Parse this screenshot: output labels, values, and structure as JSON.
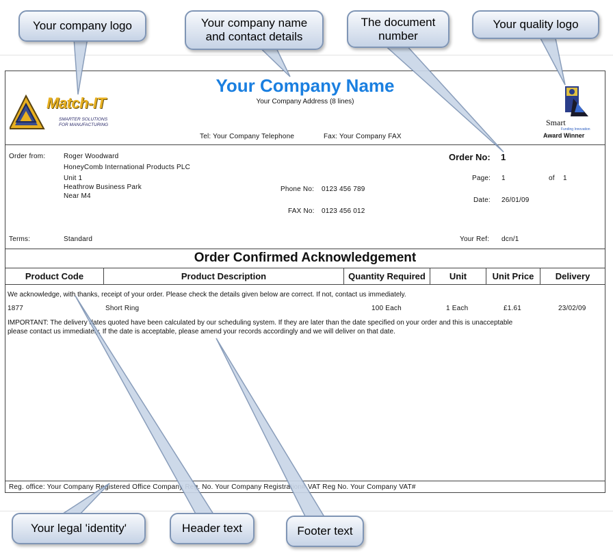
{
  "callouts": {
    "company_logo": "Your company logo",
    "company_name_l1": "Your company name",
    "company_name_l2": "and contact details",
    "doc_number_l1": "The document",
    "doc_number_l2": "number",
    "quality_logo": "Your quality logo",
    "legal_identity": "Your legal 'identity'",
    "header_text": "Header text",
    "footer_text": "Footer text"
  },
  "company": {
    "name": "Your Company Name",
    "address": "Your Company Address (8 lines)",
    "telephone": "Tel: Your Company Telephone",
    "fax": "Fax: Your Company FAX"
  },
  "logos": {
    "left_title": "Match-IT",
    "left_tag1": "SMARTER SOLUTIONS",
    "left_tag2": "FOR MANUFACTURING",
    "smart": "Smart",
    "smart_tiny": "Funding Innovation",
    "award": "Award Winner"
  },
  "order": {
    "order_from_label": "Order from:",
    "contact": "Roger Woodward",
    "company": "HoneyComb International Products PLC",
    "addr1": "Unit 1",
    "addr2": "Heathrow Business Park",
    "addr3": "Near M4",
    "phone_label": "Phone No:",
    "phone": "0123 456 789",
    "fax_label": "FAX No:",
    "fax": "0123 456 012",
    "order_no_label": "Order No:",
    "order_no": "1",
    "page_label": "Page:",
    "page": "1",
    "of_label": "of",
    "page_total": "1",
    "date_label": "Date:",
    "date": "26/01/09",
    "terms_label": "Terms:",
    "terms": "Standard",
    "your_ref_label": "Your Ref:",
    "your_ref": "dcn/1"
  },
  "title": "Order Confirmed Acknowledgement",
  "columns": [
    "Product Code",
    "Product Description",
    "Quantity Required",
    "Unit",
    "Unit Price",
    "Delivery"
  ],
  "header_text": "We acknowledge, with thanks, receipt of your order. Please check the details given below are correct. If not, contact us immediately.",
  "line_item": {
    "code": "1877",
    "description": "Short Ring",
    "quantity": "100 Each",
    "unit": "1 Each",
    "unit_price": "£1.61",
    "delivery": "23/02/09"
  },
  "footer_text_l1": "IMPORTANT: The delivery dates quoted have been calculated by our scheduling system. If they are later than the date specified on your order and this is unacceptable",
  "footer_text_l2": "please contact us immediately. If the date is acceptable, please amend your records accordingly and we will deliver on that date.",
  "legal": "Reg. office: Your Company Registered Office Company Reg. No. Your Company Registration# VAT Reg No. Your Company VAT#"
}
